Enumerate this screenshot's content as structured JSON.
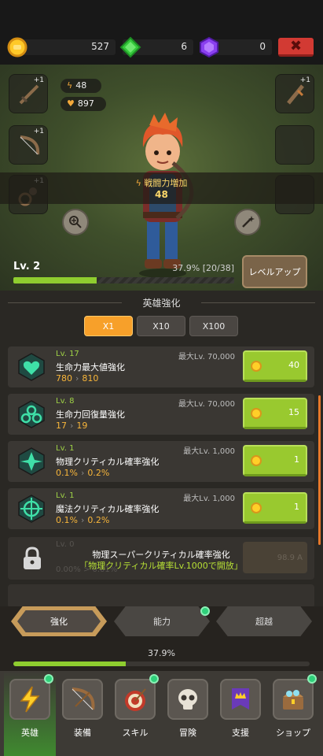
{
  "currencies": {
    "gold": "527",
    "green_gem": "6",
    "purple_gem": "0"
  },
  "hero": {
    "attack": "48",
    "hp": "897",
    "boost_label": "戦闘力増加",
    "boost_value": "48",
    "slot_plus": "+1"
  },
  "level": {
    "label": "Lv. 2",
    "progress_text": "37.9% [20/38]",
    "progress_fraction": 0.379,
    "levelup_label": "レベルアップ"
  },
  "section_title": "英雄強化",
  "multipliers": [
    "X1",
    "X10",
    "X100"
  ],
  "upgrades": [
    {
      "lv": "Lv. 17",
      "name": "生命力最大値強化",
      "from": "780",
      "to": "810",
      "max": "最大Lv. 70,000",
      "cost": "40",
      "icon": "heart-icon"
    },
    {
      "lv": "Lv. 8",
      "name": "生命力回復量強化",
      "from": "17",
      "to": "19",
      "max": "最大Lv. 70,000",
      "cost": "15",
      "icon": "regen-icon"
    },
    {
      "lv": "Lv. 1",
      "name": "物理クリティカル確率強化",
      "from": "0.1%",
      "to": "0.2%",
      "max": "最大Lv. 1,000",
      "cost": "1",
      "icon": "physical-crit-icon"
    },
    {
      "lv": "Lv. 1",
      "name": "魔法クリティカル確率強化",
      "from": "0.1%",
      "to": "0.2%",
      "max": "最大Lv. 1,000",
      "cost": "1",
      "icon": "magic-crit-icon"
    }
  ],
  "locked": {
    "title": "物理スーパークリティカル確率強化",
    "condition": "「物理クリティカル確率Lv.1000で開放」",
    "ghost_lv": "Lv. 0",
    "ghost_vals": "0.00%  >  0.01%",
    "ghost_cost": "98.9 A"
  },
  "tabs": [
    "強化",
    "能力",
    "超越"
  ],
  "total_progress": {
    "text": "37.9%",
    "fraction": 0.379
  },
  "nav": [
    {
      "label": "英雄",
      "icon": "lightning-icon"
    },
    {
      "label": "装備",
      "icon": "bow-icon"
    },
    {
      "label": "スキル",
      "icon": "target-icon"
    },
    {
      "label": "冒険",
      "icon": "skull-icon"
    },
    {
      "label": "支援",
      "icon": "crown-banner-icon"
    },
    {
      "label": "ショップ",
      "icon": "treasure-chest-icon"
    }
  ]
}
